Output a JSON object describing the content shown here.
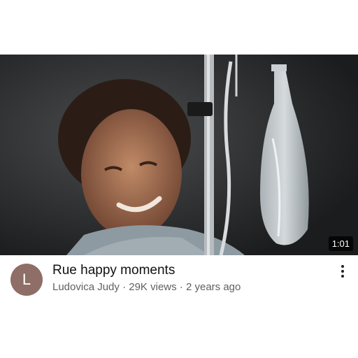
{
  "video": {
    "duration": "1:01",
    "title": "Rue happy moments",
    "channel_initial": "L",
    "channel_name": "Ludovica Judy",
    "views": "29K views",
    "age": "2 years ago",
    "separator": " · "
  },
  "icons": {
    "more": "more-vert-icon"
  },
  "colors": {
    "avatar_bg": "#8e6e66",
    "title_text": "#111111",
    "meta_text": "#606060"
  }
}
